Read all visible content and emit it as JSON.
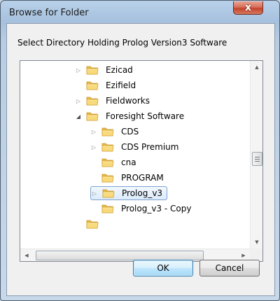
{
  "window": {
    "title": "Browse for Folder",
    "close_glyph": "x"
  },
  "dialog": {
    "prompt": "Select Directory Holding Prolog Version3 Software"
  },
  "tree": {
    "items": [
      {
        "label": "Ezicad",
        "expander": "collapsed",
        "depth": 0
      },
      {
        "label": "Ezifield",
        "expander": "none",
        "depth": 0
      },
      {
        "label": "Fieldworks",
        "expander": "collapsed",
        "depth": 0
      },
      {
        "label": "Foresight Software",
        "expander": "expanded",
        "depth": 0
      },
      {
        "label": "CDS",
        "expander": "collapsed",
        "depth": 1
      },
      {
        "label": "CDS Premium",
        "expander": "collapsed",
        "depth": 1
      },
      {
        "label": "cna",
        "expander": "none",
        "depth": 1
      },
      {
        "label": "PROGRAM",
        "expander": "none",
        "depth": 1
      },
      {
        "label": "Prolog_v3",
        "expander": "collapsed",
        "depth": 1,
        "selected": true
      },
      {
        "label": "Prolog_v3 - Copy",
        "expander": "none",
        "depth": 1
      }
    ],
    "partial_item_glyph": "·"
  },
  "buttons": {
    "ok": "OK",
    "cancel": "Cancel"
  },
  "icons": {
    "folder": "folder-icon",
    "expander_collapsed": "triangle-right-icon",
    "expander_expanded": "triangle-down-icon"
  },
  "colors": {
    "selection_border": "#7da2ce",
    "default_button_border": "#3c7fb1",
    "close_button": "#c2432d"
  }
}
